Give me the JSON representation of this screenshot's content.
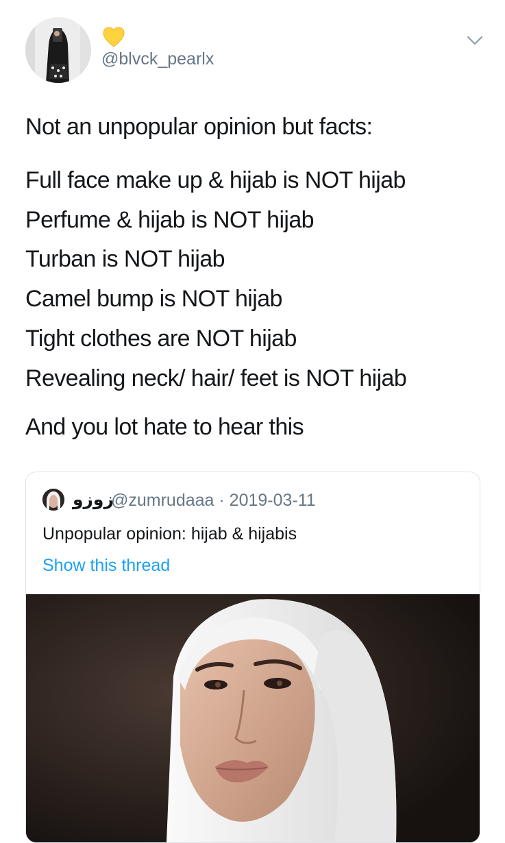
{
  "author": {
    "handle": "@blvck_pearlx",
    "display_name_icon": "yellow-heart-icon",
    "menu_icon": "chevron-down-icon"
  },
  "tweet": {
    "lines": [
      "Not an unpopular opinion but facts:",
      "Full face make up & hijab is NOT hijab",
      "Perfume & hijab is NOT hijab",
      "Turban is NOT hijab",
      "Camel bump is NOT hijab",
      "Tight clothes are NOT hijab",
      "Revealing neck/ hair/ feet is NOT hijab",
      "And you lot hate to hear this"
    ]
  },
  "quoted_tweet": {
    "display_name": "زوزو",
    "handle": "@zumrudaaa",
    "date": "2019-03-11",
    "text": "Unpopular opinion: hijab & hijabis",
    "link_label": "Show this thread"
  },
  "colors": {
    "text": "#14171a",
    "secondary": "#657786",
    "link": "#1da1f2",
    "border": "#dfe3e8",
    "heart": "#ffd23f"
  }
}
